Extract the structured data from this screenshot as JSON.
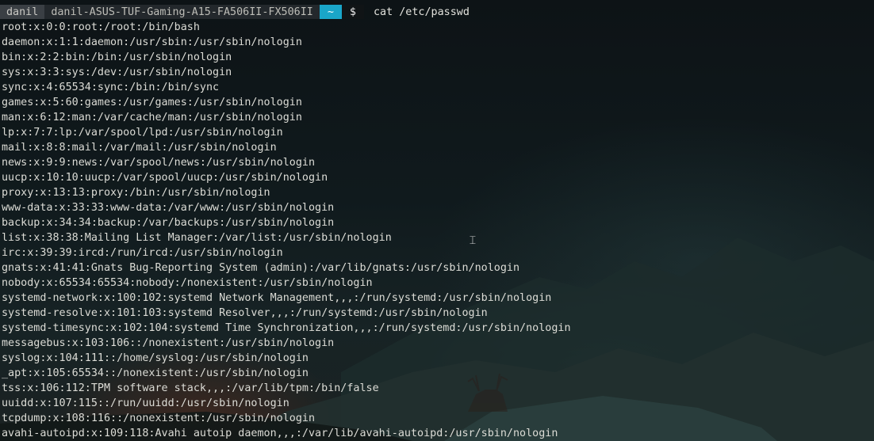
{
  "prompt": {
    "user": "danil",
    "host": "danil-ASUS-TUF-Gaming-A15-FA506II-FX506II",
    "directory": "~",
    "symbol": "$",
    "command": "cat /etc/passwd"
  },
  "output_lines": [
    "root:x:0:0:root:/root:/bin/bash",
    "daemon:x:1:1:daemon:/usr/sbin:/usr/sbin/nologin",
    "bin:x:2:2:bin:/bin:/usr/sbin/nologin",
    "sys:x:3:3:sys:/dev:/usr/sbin/nologin",
    "sync:x:4:65534:sync:/bin:/bin/sync",
    "games:x:5:60:games:/usr/games:/usr/sbin/nologin",
    "man:x:6:12:man:/var/cache/man:/usr/sbin/nologin",
    "lp:x:7:7:lp:/var/spool/lpd:/usr/sbin/nologin",
    "mail:x:8:8:mail:/var/mail:/usr/sbin/nologin",
    "news:x:9:9:news:/var/spool/news:/usr/sbin/nologin",
    "uucp:x:10:10:uucp:/var/spool/uucp:/usr/sbin/nologin",
    "proxy:x:13:13:proxy:/bin:/usr/sbin/nologin",
    "www-data:x:33:33:www-data:/var/www:/usr/sbin/nologin",
    "backup:x:34:34:backup:/var/backups:/usr/sbin/nologin",
    "list:x:38:38:Mailing List Manager:/var/list:/usr/sbin/nologin",
    "irc:x:39:39:ircd:/run/ircd:/usr/sbin/nologin",
    "gnats:x:41:41:Gnats Bug-Reporting System (admin):/var/lib/gnats:/usr/sbin/nologin",
    "nobody:x:65534:65534:nobody:/nonexistent:/usr/sbin/nologin",
    "systemd-network:x:100:102:systemd Network Management,,,:/run/systemd:/usr/sbin/nologin",
    "systemd-resolve:x:101:103:systemd Resolver,,,:/run/systemd:/usr/sbin/nologin",
    "systemd-timesync:x:102:104:systemd Time Synchronization,,,:/run/systemd:/usr/sbin/nologin",
    "messagebus:x:103:106::/nonexistent:/usr/sbin/nologin",
    "syslog:x:104:111::/home/syslog:/usr/sbin/nologin",
    "_apt:x:105:65534::/nonexistent:/usr/sbin/nologin",
    "tss:x:106:112:TPM software stack,,,:/var/lib/tpm:/bin/false",
    "uuidd:x:107:115::/run/uuidd:/usr/sbin/nologin",
    "tcpdump:x:108:116::/nonexistent:/usr/sbin/nologin",
    "avahi-autoipd:x:109:118:Avahi autoip daemon,,,:/var/lib/avahi-autoipd:/usr/sbin/nologin"
  ],
  "colors": {
    "directory_segment": "#1aa6c9",
    "text": "#dcdcd6"
  },
  "icons": {
    "mouse_cursor": "text-cursor-icon"
  }
}
